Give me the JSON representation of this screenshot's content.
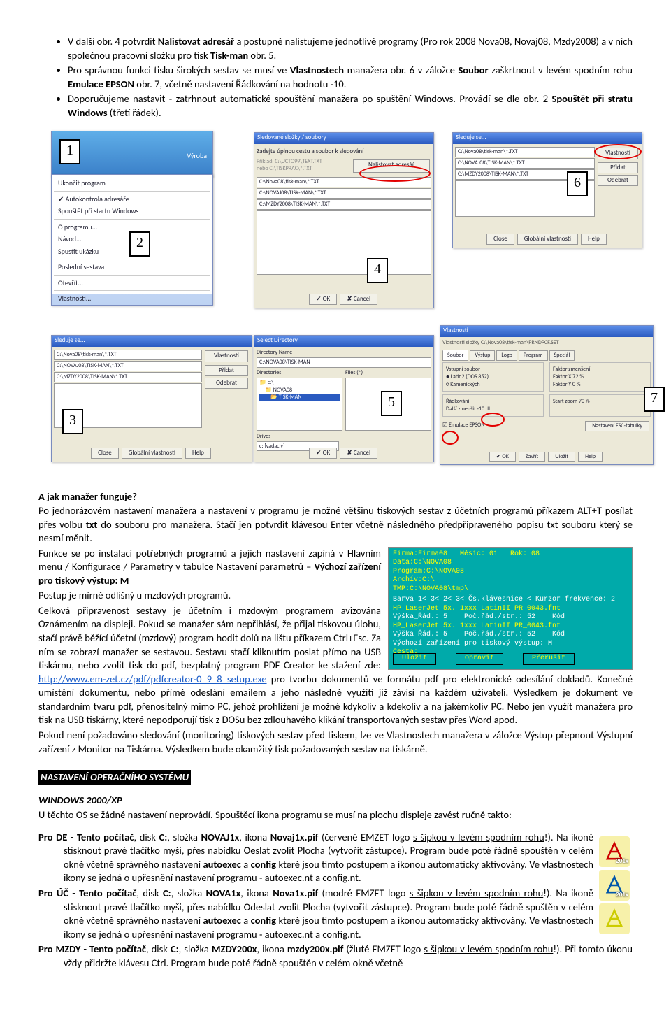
{
  "bullets": [
    {
      "pre": "V další obr. 4 potvrdit ",
      "b1": "Nalistovat adresář",
      "mid1": " a postupně nalistujeme jednotlivé programy (Pro rok 2008 Nova08, Novaj08, Mzdy2008) a v nich společnou pracovní složku pro tisk ",
      "b2": "Tisk-man",
      "post": " obr. 5."
    },
    {
      "pre": "Pro správnou funkci tisku širokých sestav se musí ve ",
      "b1": "Vlastnostech",
      "mid1": " manažera obr. 6 v záložce ",
      "b2": "Soubor",
      "mid2": " zaškrtnout v levém spodním rohu ",
      "b3": "Emulace EPSON",
      "post": " obr. 7, včetně nastavení Řádkování na hodnotu  -10."
    },
    {
      "pre": "Doporučujeme nastavit - zatrhnout automatické spouštění manažera po spuštění Windows. Provádí se dle obr. 2 ",
      "b1": "Spouštět při stratu Windows",
      "post": " (třetí řádek)."
    }
  ],
  "numtags": {
    "n1": "1",
    "n2": "2",
    "n3": "3",
    "n4": "4",
    "n5": "5",
    "n6": "6",
    "n7": "7"
  },
  "shots": {
    "s1": {
      "title": "Výroba",
      "menu": [
        "Ukončit program",
        "Autokontrola adresáře",
        "Spouštět při startu Windows",
        "O programu...",
        "Návod...",
        "Spustit ukázku",
        "Poslední sestava",
        "Otevřít...",
        "Vlastnosti..."
      ]
    },
    "s3": {
      "title": "Sleduje se...",
      "rows": [
        "C:\\Nova08\\tisk-man\\*.TXT",
        "C:\\NOVAJ08\\TISK-MAN\\*.TXT",
        "C:\\MZDY2008\\TISK-MAN\\*.TXT"
      ],
      "side": [
        "Vlastnosti",
        "Přidat",
        "Odebrat"
      ],
      "foot": [
        "Close",
        "Globální vlastnosti",
        "Help"
      ]
    },
    "s4": {
      "title": "Sledované složky / soubory",
      "heading": "Zadejte úplnou cestu a soubor k sledování",
      "lines": [
        "Příklad:  C:\\UCTO99\\TEXT.TXT",
        "nebo   C:\\TISKPRAC\\*.TXT"
      ],
      "btn": "Nalistovat adresář",
      "rows": [
        "C:\\Nova08\\tisk-man\\*.TXT",
        "C:\\NOVAJ08\\TISK-MAN\\*.TXT",
        "C:\\MZDY2008\\TISK-MAN\\*.TXT"
      ],
      "foot": [
        "OK",
        "Cancel"
      ]
    },
    "s5": {
      "title": "Select Directory",
      "dirname": "Directory Name",
      "dirval": "C:\\NOVA08\\TISK-MAN",
      "dirs": [
        "c:\\",
        "NOVA08",
        "TISK-MAN"
      ],
      "files": "Files (*)",
      "drive": "c: [vadaciv]",
      "foot": [
        "OK",
        "Cancel"
      ]
    },
    "s6": {
      "title": "Sleduje se...",
      "rows": [
        "C:\\Nova08\\tisk-man\\*.TXT",
        "C:\\NOVAJ08\\TISK-MAN\\*.TXT",
        "C:\\MZDY2008\\TISK-MAN\\*.TXT"
      ],
      "side": [
        "Vlastnosti",
        "Přidat",
        "Odebrat"
      ],
      "foot": [
        "Close",
        "Globální vlastnosti",
        "Help"
      ]
    },
    "s7": {
      "title": "Vlastnosti",
      "path": "Vlastnosti složky C:\\Nova08\\tisk-man\\PRNDPCF.SET",
      "tabs": [
        "Soubor",
        "Výstup",
        "Logo",
        "Program",
        "Speciál"
      ],
      "left": [
        "Vstupní soubor",
        "● Latin2 (DOS 852)",
        "○ Kamenických"
      ],
      "right": [
        "Faktor zmenšení",
        "Faktor X  72  %",
        "Faktor Y  0  %"
      ],
      "rowlow": [
        "Řádkování",
        "Další zmenšit  -10  dl"
      ],
      "rowlow2": [
        "Start zoom  70  %"
      ],
      "chk": "Emulace EPSON",
      "btn2": "Nastavení ESC-tabulky",
      "foot": [
        "OK",
        "Zavřít",
        "Uložit",
        "Help"
      ]
    }
  },
  "manager": {
    "h": "A jak manažer funguje?",
    "p1": "Po jednorázovém nastavení manažera a nastavení v programu je možné většinu tiskových sestav z účetních programů příkazem ALT+T posílat přes volbu ",
    "b1": "txt",
    "p2": " do souboru pro manažera. Stačí jen potvrdit klávesou Enter včetně následného předpřipraveného popisu txt souboru který se nesmí měnit.",
    "p3a": "Funkce se po instalaci potřebných programů a jejich nastavení zapíná v Hlavním menu / Konfigurace / Parametry v tabulce Nastavení parametrů – ",
    "b3": "Výchozí zařízení pro tiskový výstup: M",
    "p3b": "Postup je mírně odlišný u mzdových programů.",
    "p4": "Celková připravenost sestavy je účetním i mzdovým programem avizována Oznámením na displeji. Pokud se manažer sám nepřihlásí, že přijal tiskovou úlohu, stačí právě běžící účetní (mzdový) program hodit dolů na lištu příkazem Ctrl+Esc. Za ním se zobrazí manažer se sestavou. Sestavu stačí kliknutím poslat přímo na USB tiskárnu, nebo zvolit tisk do pdf, bezplatný program PDF Creator ke stažení zde: ",
    "link": "http://www.em-zet.cz/pdf/pdfcreator-0_9_8_setup.exe",
    "p5": " pro tvorbu dokumentů ve formátu pdf pro elektronické odesílání dokladů. Konečné umístění dokumentu, nebo přímé odeslání emailem a jeho následné využití již závisí na každém uživateli. Výsledkem je dokument ve standardním tvaru pdf, přenositelný mimo PC, jehož prohlížení je možné kdykoliv a kdekoliv a na jakémkoliv PC. Nebo jen využít manažera pro tisk na USB tiskárny, které nepodporují tisk z DOSu bez zdlouhavého klikání transportovaných sestav přes Word apod.",
    "p6": "Pokud není požadováno sledování (monitoring) tiskových sestav před tiskem, lze ve Vlastnostech manažera v záložce Výstup přepnout Výstupní zařízení z Monitor na Tiskárna. Výsledkem bude okamžitý tisk požadovaných sestav na tiskárně."
  },
  "dos": {
    "l1": "Firma:Firma08   Měsíc: 01   Rok: 08",
    "l2": "Data:C:\\NOVA08",
    "l3": "Program:C:\\NOVA08",
    "l4": "Archív:C:\\",
    "l5": "TMP:C:\\NOVA08\\tmp\\",
    "l6": "Barva 1< 3< 2< 3< Čs.klávesnice < Kurzor frekvence: 2",
    "l7": "HP_LaserJet 5x. 1xxx LatinII PR_0043.fnt",
    "l8": "Výška_Řád.: 5    Poč.řád./str.: 52    Kód  ",
    "l9": "HP_LaserJet 5x. 1xxx LatinII PR_0043.fnt",
    "l10": "Výška_Řád.: 5    Poč.řád./str.: 52    Kód  ",
    "l11": "Výchozí zařízení pro tiskový výstup: M",
    "l12": "Cesta:",
    "b1": "Uložit",
    "b2": "Opravit",
    "b3": "Přerušit"
  },
  "os": {
    "h": "NASTAVENÍ OPERAČNÍHO SYSTÉMU",
    "sub": "WINDOWS 2000/XP",
    "p": "U těchto OS se žádné nastavení neprovádí. Spouštěcí ikona programu se musí na plochu displeje zavést ručně takto:",
    "de": {
      "lead": "Pro DE - Tento počítač",
      "mid": ", disk ",
      "c": "C:",
      "mid2": ", složka ",
      "f": "NOVAJ1x",
      "mid3": ", ikona ",
      "i": "Novaj1x.pif",
      "par": " (červené EMZET logo ",
      "u": "s šipkou v levém spodním rohu",
      "end": "!). Na ikoně stisknout pravé tlačítko myši, přes nabídku Oeslat zvolit Plocha (vytvořit zástupce). Program bude poté řádně spouštěn v celém okně včetně správného nastavení ",
      "b1": "autoexec",
      "and": " a ",
      "b2": "config",
      "tail": " které jsou tímto postupem a ikonou automaticky aktivovány. Ve vlastnostech ikony se jedná o upřesnění nastavení programu - autoexec.nt a config.nt."
    },
    "uc": {
      "lead": "Pro ÚČ - Tento počítač",
      "mid": ", disk ",
      "c": "C:",
      "mid2": ", složka ",
      "f": "NOVA1x",
      "mid3": ", ikona ",
      "i": "Nova1x.pif",
      "par": " (modré EMZET logo ",
      "u": "s šipkou v levém spodním rohu",
      "end": "!). Na ikoně stisknout pravé tlačítko myši, přes nabídku Odeslat zvolit Plocha (vytvořit zástupce). Program bude poté řádně spuštěn v celém okně včetně správného nastavení ",
      "b1": "autoexec",
      "and": " a ",
      "b2": "config",
      "tail": " které jsou tímto postupem a ikonou automaticky aktivovány. Ve vlastnostech ikony se jedná o upřesnění nastavení programu - autoexec.nt a config.nt."
    },
    "mz": {
      "lead": "Pro MZDY - Tento počítač",
      "mid": ", disk ",
      "c": "C:",
      "mid2": ", složka ",
      "f": "MZDY200x",
      "mid3": ", ikona ",
      "i": "mzdy200x.pif",
      "par": " (žluté EMZET logo ",
      "u": "s šipkou v levém spodním rohu",
      "end": "!). Při tomto úkonu vždy přidržte klávesu Ctrl. Program bude poté řádně spouštěn v celém okně včetně"
    }
  },
  "iconlbl": "201x"
}
